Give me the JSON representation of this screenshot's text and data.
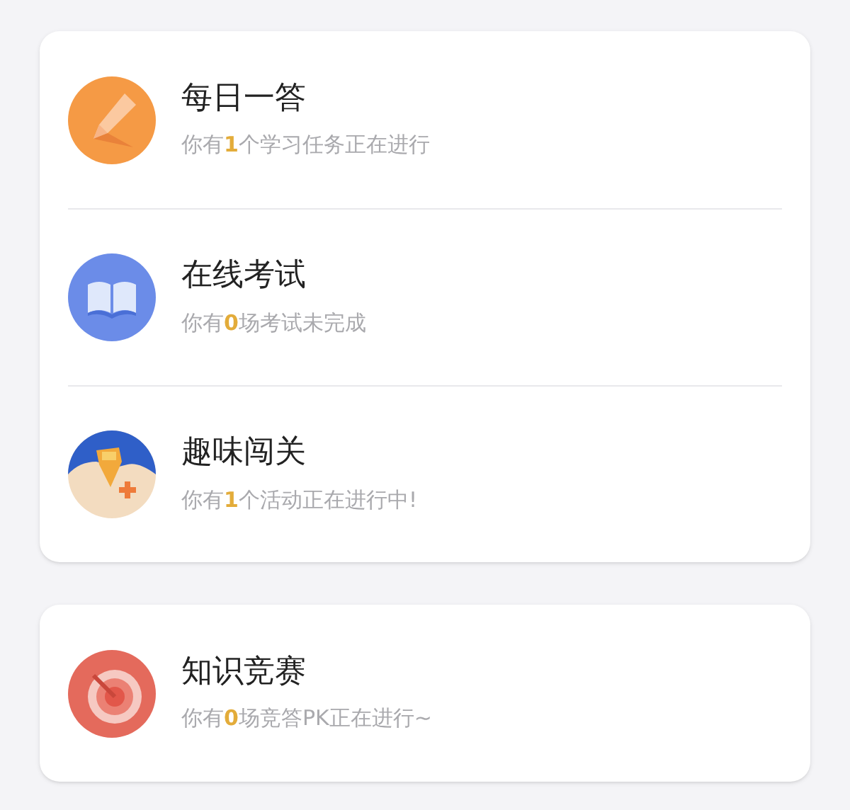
{
  "groups": [
    {
      "items": [
        {
          "kind": "pencil",
          "title": "每日一答",
          "subtitle_before": "你有",
          "count": "1",
          "subtitle_after": "个学习任务正在进行"
        },
        {
          "kind": "book",
          "title": "在线考试",
          "subtitle_before": "你有",
          "count": "0",
          "subtitle_after": "场考试未完成"
        },
        {
          "kind": "map",
          "title": "趣味闯关",
          "subtitle_before": "你有",
          "count": "1",
          "subtitle_after": "个活动正在进行中!"
        }
      ]
    },
    {
      "items": [
        {
          "kind": "target",
          "title": "知识竞赛",
          "subtitle_before": "你有",
          "count": "0",
          "subtitle_after": "场竞答PK正在进行~"
        }
      ]
    }
  ]
}
